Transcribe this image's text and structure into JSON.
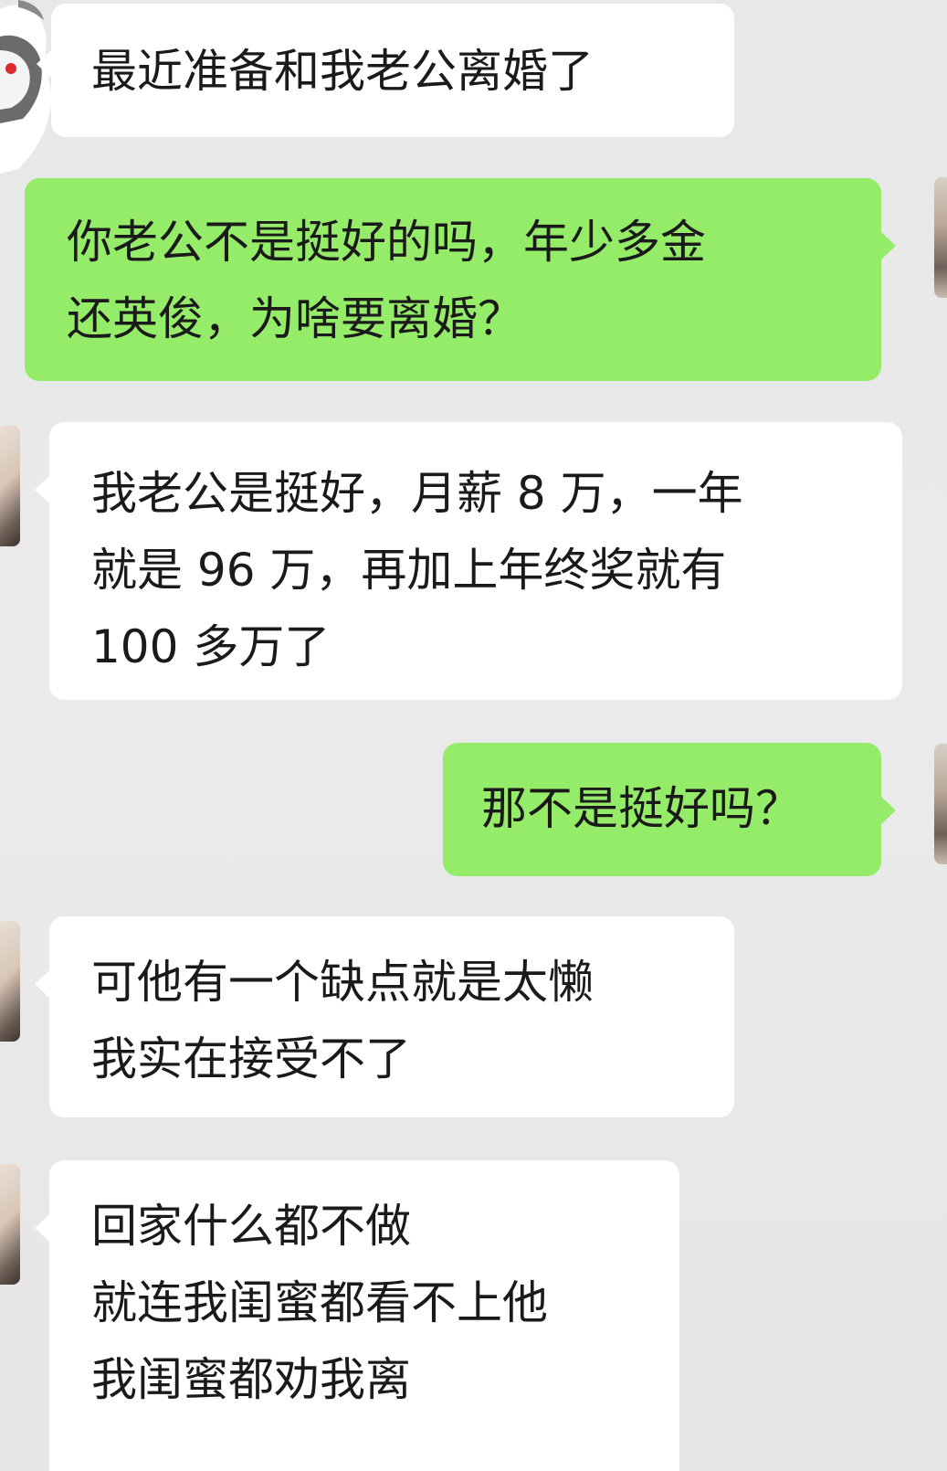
{
  "chat": {
    "messages": [
      {
        "side": "incoming",
        "lines": [
          "最近准备和我老公离婚了"
        ]
      },
      {
        "side": "outgoing",
        "lines": [
          "你老公不是挺好的吗，年少多金",
          "还英俊，为啥要离婚？"
        ]
      },
      {
        "side": "incoming",
        "lines": [
          "我老公是挺好，月薪 8 万，一年",
          "就是 96 万，再加上年终奖就有",
          "100 多万了"
        ]
      },
      {
        "side": "outgoing",
        "lines": [
          "那不是挺好吗？"
        ]
      },
      {
        "side": "incoming",
        "lines": [
          "可他有一个缺点就是太懒",
          "我实在接受不了"
        ]
      },
      {
        "side": "incoming",
        "lines": [
          "回家什么都不做",
          "就连我闺蜜都看不上他",
          "我闺蜜都劝我离"
        ]
      }
    ]
  },
  "colors": {
    "background": "#ebebeb",
    "incoming_bubble": "#ffffff",
    "outgoing_bubble": "#95ec69",
    "text": "#1a1a1a"
  },
  "icons": {
    "contact_avatar": "cartoon-rabbit-avatar",
    "friend_avatar": "photo-avatar",
    "self_avatar": "photo-avatar"
  }
}
